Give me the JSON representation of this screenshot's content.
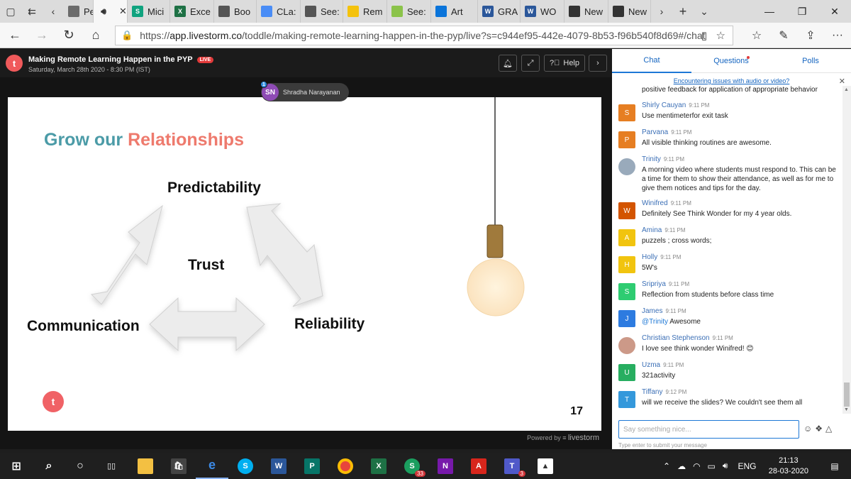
{
  "browser": {
    "tabs": [
      {
        "label": "Peo",
        "fav": "",
        "color": "#6b6b6b"
      },
      {
        "label": "",
        "fav": "speaker-icon",
        "color": "#444",
        "active": true
      },
      {
        "label": "Mici",
        "fav": "S",
        "color": "#10a37f"
      },
      {
        "label": "Exce",
        "fav": "X",
        "color": "#1e7145"
      },
      {
        "label": "Boo",
        "fav": "",
        "color": "#555"
      },
      {
        "label": "CLa:",
        "fav": "",
        "color": "#4a8df6"
      },
      {
        "label": "See:",
        "fav": "",
        "color": "#555"
      },
      {
        "label": "Rem",
        "fav": "",
        "color": "#f4c20d"
      },
      {
        "label": "See:",
        "fav": "",
        "color": "#8bc34a"
      },
      {
        "label": "Art",
        "fav": "",
        "color": "#0a74da"
      },
      {
        "label": "GRA",
        "fav": "W",
        "color": "#2b579a"
      },
      {
        "label": "WO",
        "fav": "W",
        "color": "#2b579a"
      },
      {
        "label": "New",
        "fav": "",
        "color": "#333"
      },
      {
        "label": "New",
        "fav": "",
        "color": "#333"
      }
    ],
    "url_prefix": "https://",
    "url_host": "app.livestorm.co",
    "url_path": "/toddle/making-remote-learning-happen-in-the-pyp/live?s=c944ef95-442e-4079-8b53-f96b540f8d69#/chat"
  },
  "webinar": {
    "logo_letter": "t",
    "title": "Making Remote Learning Happen in the PYP",
    "live_badge": "LIVE",
    "date": "Saturday, March 28th 2020 - 8:30 PM (IST)",
    "help_label": "Help",
    "speaker_initials": "SN",
    "speaker_badge": "1",
    "speaker_name": "Shradha Narayanan",
    "powered_by": "Powered by",
    "powered_brand": "livestorm"
  },
  "slide": {
    "title_part1": "Grow our",
    "title_part2": "Relationships",
    "label_top": "Predictability",
    "label_center": "Trust",
    "label_left": "Communication",
    "label_right": "Reliability",
    "number": "17",
    "logo_letter": "t",
    "colors": {
      "teal": "#4b9ba7",
      "coral": "#ee7a6d"
    }
  },
  "panel": {
    "tabs": [
      "Chat",
      "Questions",
      "Polls"
    ],
    "issue_text": "Encountering issues with audio or video?",
    "messages": [
      {
        "name": "",
        "time": "",
        "text": "positive feedback for application of appropriate behavior",
        "initial": "",
        "color": "#5b7bb0"
      },
      {
        "name": "Shirly Cauyan",
        "time": "9:11 PM",
        "text": "Use mentimeterfor exit task",
        "initial": "S",
        "color": "#e67e22"
      },
      {
        "name": "Parvana",
        "time": "9:11 PM",
        "text": "All visible thinking routines are awesome.",
        "initial": "P",
        "color": "#e67e22"
      },
      {
        "name": "Trinity",
        "time": "9:11 PM",
        "text": "A morning video where students must respond to. This can be a time for them to show their attendance, as well as for me to give them notices and tips for the day.",
        "initial": "",
        "color": "#9ab"
      },
      {
        "name": "Winifred",
        "time": "9:11 PM",
        "text": "Definitely See Think Wonder for my 4 year olds.",
        "initial": "W",
        "color": "#d35400"
      },
      {
        "name": "Amina",
        "time": "9:11 PM",
        "text": "puzzels ; cross words;",
        "initial": "A",
        "color": "#f1c40f"
      },
      {
        "name": "Holly",
        "time": "9:11 PM",
        "text": "5W's",
        "initial": "H",
        "color": "#f1c40f"
      },
      {
        "name": "Sripriya",
        "time": "9:11 PM",
        "text": "Reflection from students before class time",
        "initial": "S",
        "color": "#2ecc71"
      },
      {
        "name": "James",
        "time": "9:11 PM",
        "text": "Awesome",
        "mention": "@Trinity",
        "initial": "J",
        "color": "#2d7be0"
      },
      {
        "name": "Christian Stephenson",
        "time": "9:11 PM",
        "text": "I love see think wonder Winifred! 😊",
        "initial": "",
        "color": "#c98"
      },
      {
        "name": "Uzma",
        "time": "9:11 PM",
        "text": "321activity",
        "initial": "U",
        "color": "#27ae60"
      },
      {
        "name": "Tiffany",
        "time": "9:12 PM",
        "text": "will we receive the slides? We couldn't see them all",
        "initial": "T",
        "color": "#3498db"
      }
    ],
    "input_placeholder": "Say something nice...",
    "hint": "Type enter to submit your message"
  },
  "taskbar": {
    "language": "ENG",
    "time": "21:13",
    "date": "28-03-2020",
    "skype_badge": "33",
    "teams_badge": "3"
  }
}
